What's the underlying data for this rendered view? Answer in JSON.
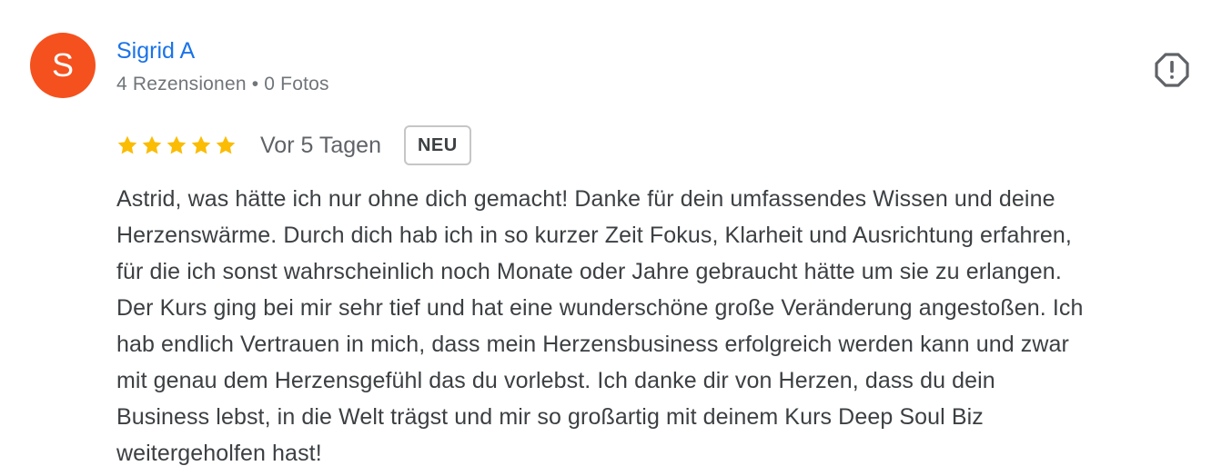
{
  "review": {
    "author": {
      "initial": "S",
      "name": "Sigrid A",
      "reviews_count": "4 Rezensionen",
      "separator": "•",
      "photos_count": "0 Fotos",
      "avatar_color": "#f4511e"
    },
    "rating": {
      "stars": 5,
      "max_stars": 5,
      "star_color": "#fbbc04"
    },
    "date": "Vor 5 Tagen",
    "badge": "NEU",
    "report_icon": "report-flag-icon",
    "text_lines": [
      "Astrid, was hätte ich nur ohne dich gemacht! Danke für dein umfassendes Wissen und deine",
      "Herzenswärme. Durch dich hab ich in so kurzer Zeit Fokus, Klarheit und Ausrichtung erfahren,",
      "für die ich sonst wahrscheinlich noch Monate oder Jahre gebraucht hätte um sie zu erlangen.",
      "Der Kurs ging bei mir sehr tief und hat eine wunderschöne große Veränderung angestoßen. Ich",
      "hab endlich Vertrauen in mich, dass mein Herzensbusiness erfolgreich werden kann und zwar",
      "mit genau dem Herzensgefühl das du vorlebst. Ich danke dir von Herzen, dass du dein",
      "Business lebst, in die Welt trägst und mir so großartig mit deinem Kurs Deep Soul Biz",
      "weitergeholfen hast!"
    ]
  }
}
